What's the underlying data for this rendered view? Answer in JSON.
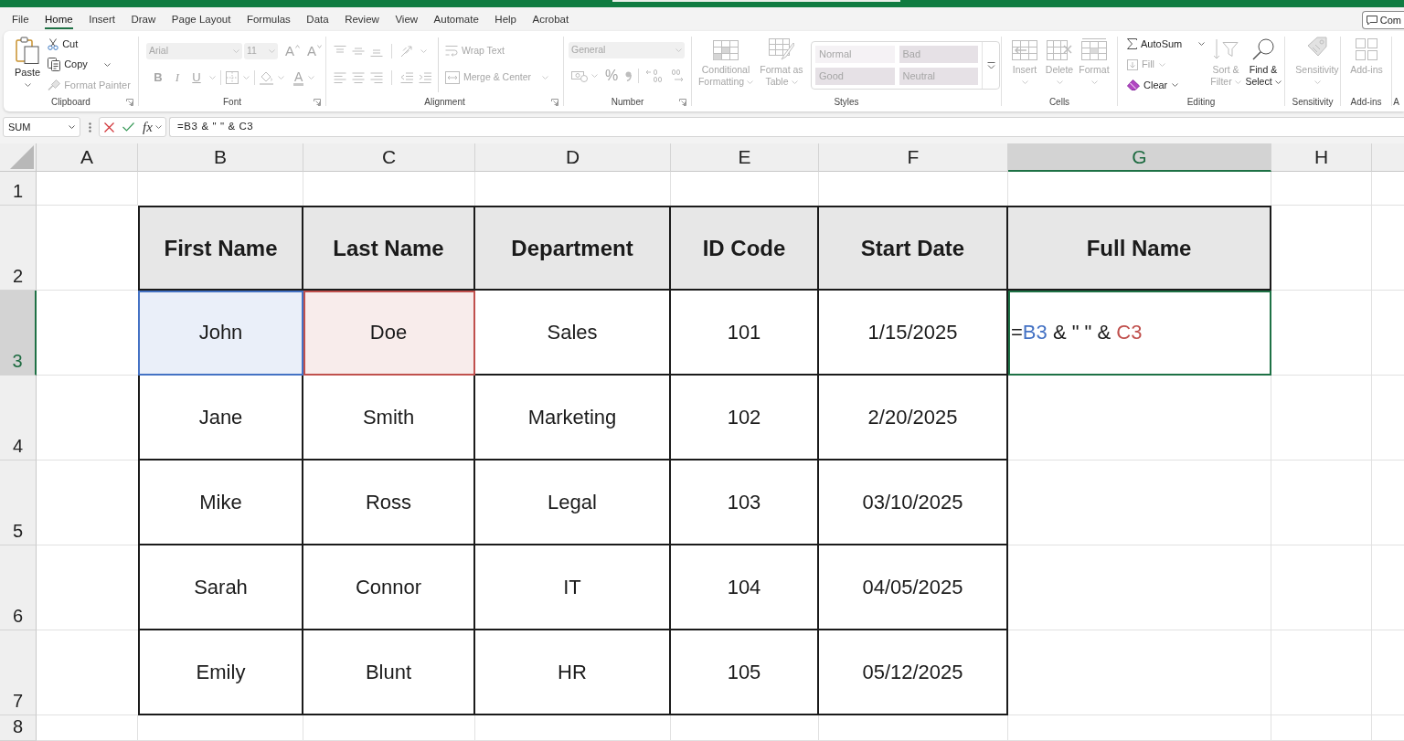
{
  "menu_tabs": [
    {
      "label": "File",
      "selected": false
    },
    {
      "label": "Home",
      "selected": true
    },
    {
      "label": "Insert",
      "selected": false
    },
    {
      "label": "Draw",
      "selected": false
    },
    {
      "label": "Page Layout",
      "selected": false
    },
    {
      "label": "Formulas",
      "selected": false
    },
    {
      "label": "Data",
      "selected": false
    },
    {
      "label": "Review",
      "selected": false
    },
    {
      "label": "View",
      "selected": false
    },
    {
      "label": "Automate",
      "selected": false
    },
    {
      "label": "Help",
      "selected": false
    },
    {
      "label": "Acrobat",
      "selected": false
    }
  ],
  "comments_button": {
    "label": "Com"
  },
  "ribbon": {
    "groups": [
      {
        "kind": "clipboard",
        "label": "Clipboard",
        "paste": {
          "label": "Paste",
          "disabled": false
        },
        "buttons": [
          {
            "label": "Cut",
            "disabled": false
          },
          {
            "label": "Copy",
            "disabled": false
          },
          {
            "label": "Format Painter",
            "disabled": true
          }
        ]
      },
      {
        "kind": "font",
        "label": "Font",
        "disabled": true,
        "font_name": "Arial",
        "font_size": "11",
        "size_buttons": [
          {
            "label": "A",
            "kind": "grow"
          },
          {
            "label": "A",
            "kind": "shrink"
          }
        ],
        "style_buttons": [
          {
            "label": "B",
            "kind": "bold"
          },
          {
            "label": "I",
            "kind": "italic"
          },
          {
            "label": "U",
            "kind": "underline"
          }
        ],
        "font_color_button": "A"
      },
      {
        "kind": "alignment",
        "label": "Alignment",
        "disabled": true,
        "wrap_text": "Wrap Text",
        "merge": "Merge & Center"
      },
      {
        "kind": "number",
        "label": "Number",
        "disabled": true,
        "format": "General",
        "percent": "%"
      },
      {
        "kind": "styles",
        "label": "Styles",
        "disabled": true,
        "buttons": [
          "Conditional Formatting",
          "Format as Table"
        ],
        "cell_styles": [
          {
            "label": "Normal",
            "color": "#f5f2f5"
          },
          {
            "label": "Bad",
            "color": "#e6e1e6"
          },
          {
            "label": "Good",
            "color": "#e6e1e6"
          },
          {
            "label": "Neutral",
            "color": "#e6e1e6"
          }
        ]
      },
      {
        "kind": "cells",
        "label": "Cells",
        "buttons": [
          {
            "label": "Insert",
            "disabled": true
          },
          {
            "label": "Delete",
            "disabled": true
          },
          {
            "label": "Format",
            "disabled": true
          }
        ]
      },
      {
        "kind": "editing",
        "label": "Editing",
        "buttons": [
          {
            "label": "AutoSum",
            "disabled": false
          },
          {
            "label": "Fill",
            "disabled": true
          },
          {
            "label": "Clear",
            "disabled": false
          },
          {
            "label": "Sort & Filter",
            "disabled": true
          },
          {
            "label": "Find & Select",
            "disabled": false
          }
        ]
      },
      {
        "kind": "sensitivity",
        "label": "Sensitivity",
        "buttons": [
          {
            "label": "Sensitivity",
            "disabled": true
          }
        ]
      },
      {
        "kind": "addins",
        "label": "Add-ins",
        "buttons": [
          {
            "label": "Add-ins",
            "disabled": true
          }
        ]
      },
      {
        "kind": "partial",
        "label": "A"
      }
    ]
  },
  "formula_bar": {
    "name_box": "SUM",
    "function_button": "fx",
    "formula": "=B3 & \" \" & C3"
  },
  "sheet": {
    "columns": [
      {
        "label": "A",
        "selected": false
      },
      {
        "label": "B",
        "selected": false
      },
      {
        "label": "C",
        "selected": false
      },
      {
        "label": "D",
        "selected": false
      },
      {
        "label": "E",
        "selected": false
      },
      {
        "label": "F",
        "selected": false
      },
      {
        "label": "G",
        "selected": true
      },
      {
        "label": "H",
        "selected": false
      }
    ],
    "rows": [
      {
        "label": "1",
        "selected": false
      },
      {
        "label": "2",
        "selected": false
      },
      {
        "label": "3",
        "selected": true
      },
      {
        "label": "4",
        "selected": false
      },
      {
        "label": "5",
        "selected": false
      },
      {
        "label": "6",
        "selected": false
      },
      {
        "label": "7",
        "selected": false
      },
      {
        "label": "8",
        "selected": false
      }
    ],
    "table": {
      "header": [
        "First Name",
        "Last Name",
        "Department",
        "ID Code",
        "Start Date",
        "Full Name"
      ],
      "rows": [
        {
          "cells": [
            {
              "kind": "text",
              "text": "John",
              "selected": false,
              "color": "#4472c4"
            },
            {
              "kind": "text",
              "text": "Doe",
              "selected": false,
              "color": "#c0504d"
            },
            {
              "kind": "text",
              "text": "Sales",
              "selected": false
            },
            {
              "kind": "text",
              "text": "101",
              "selected": false
            },
            {
              "kind": "text",
              "text": "1/15/2025",
              "selected": false
            },
            {
              "kind": "formula",
              "selected": true,
              "parts": [
                {
                  "text": "=",
                  "color": "#1b1b1b"
                },
                {
                  "text": "B3",
                  "color": "#4472c4"
                },
                {
                  "text": " & \" \" & ",
                  "color": "#1b1b1b"
                },
                {
                  "text": "C3",
                  "color": "#c0504d"
                }
              ]
            }
          ]
        },
        {
          "cells": [
            {
              "kind": "text",
              "text": "Jane",
              "selected": false
            },
            {
              "kind": "text",
              "text": "Smith",
              "selected": false
            },
            {
              "kind": "text",
              "text": "Marketing",
              "selected": false
            },
            {
              "kind": "text",
              "text": "102",
              "selected": false
            },
            {
              "kind": "text",
              "text": "2/20/2025",
              "selected": false
            }
          ]
        },
        {
          "cells": [
            {
              "kind": "text",
              "text": "Mike",
              "selected": false
            },
            {
              "kind": "text",
              "text": "Ross",
              "selected": false
            },
            {
              "kind": "text",
              "text": "Legal",
              "selected": false
            },
            {
              "kind": "text",
              "text": "103",
              "selected": false
            },
            {
              "kind": "text",
              "text": "03/10/2025",
              "selected": false
            }
          ]
        },
        {
          "cells": [
            {
              "kind": "text",
              "text": "Sarah",
              "selected": false
            },
            {
              "kind": "text",
              "text": "Connor",
              "selected": false
            },
            {
              "kind": "text",
              "text": "IT",
              "selected": false
            },
            {
              "kind": "text",
              "text": "104",
              "selected": false
            },
            {
              "kind": "text",
              "text": "04/05/2025",
              "selected": false
            }
          ]
        },
        {
          "cells": [
            {
              "kind": "text",
              "text": "Emily",
              "selected": false
            },
            {
              "kind": "text",
              "text": "Blunt",
              "selected": false
            },
            {
              "kind": "text",
              "text": "HR",
              "selected": false
            },
            {
              "kind": "text",
              "text": "105",
              "selected": false
            },
            {
              "kind": "text",
              "text": "05/12/2025",
              "selected": false
            }
          ]
        }
      ]
    }
  }
}
